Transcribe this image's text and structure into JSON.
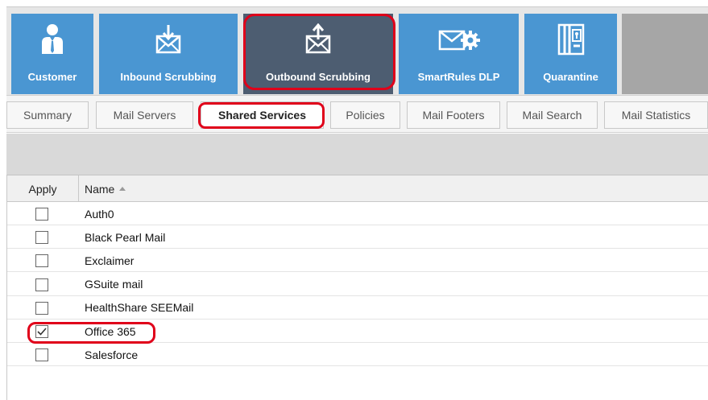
{
  "modules": [
    {
      "label": "Customer",
      "icon": "customer-icon",
      "active": false
    },
    {
      "label": "Inbound Scrubbing",
      "icon": "inbound-mail-icon",
      "active": false
    },
    {
      "label": "Outbound Scrubbing",
      "icon": "outbound-mail-icon",
      "active": true
    },
    {
      "label": "SmartRules DLP",
      "icon": "mail-gear-icon",
      "active": false
    },
    {
      "label": "Quarantine",
      "icon": "quarantine-icon",
      "active": false
    }
  ],
  "tabs": [
    {
      "label": "Summary"
    },
    {
      "label": "Mail Servers"
    },
    {
      "label": "Shared Services",
      "active": true
    },
    {
      "label": "Policies"
    },
    {
      "label": "Mail Footers"
    },
    {
      "label": "Mail Search"
    },
    {
      "label": "Mail Statistics"
    }
  ],
  "grid": {
    "columns": {
      "apply": "Apply",
      "name": "Name"
    },
    "sort": {
      "column": "Name",
      "direction": "ascending"
    },
    "rows": [
      {
        "name": "Auth0",
        "checked": false
      },
      {
        "name": "Black Pearl Mail",
        "checked": false
      },
      {
        "name": "Exclaimer",
        "checked": false
      },
      {
        "name": "GSuite mail",
        "checked": false
      },
      {
        "name": "HealthShare SEEMail",
        "checked": false
      },
      {
        "name": "Office 365",
        "checked": true
      },
      {
        "name": "Salesforce",
        "checked": false
      }
    ]
  },
  "colors": {
    "tile": "#4a96d2",
    "tile_active": "#4d5d71",
    "highlight": "#e0001a"
  }
}
